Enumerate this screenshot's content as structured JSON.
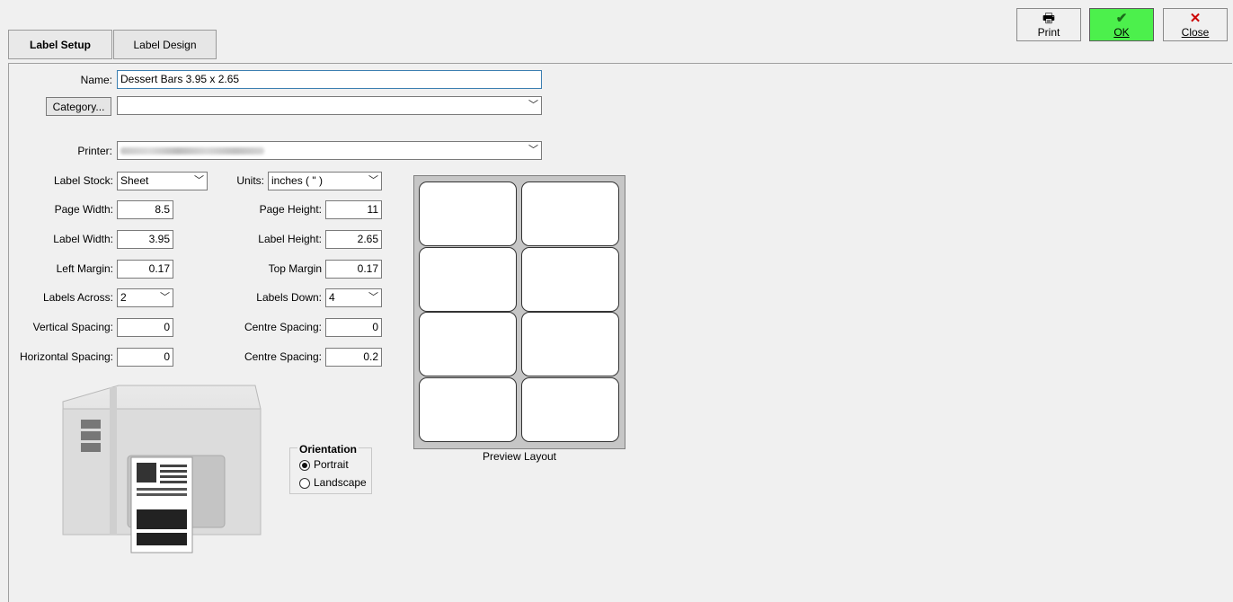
{
  "tabs": {
    "label_setup": "Label Setup",
    "label_design": "Label Design"
  },
  "toolbar": {
    "print": "Print",
    "ok": "OK",
    "close": "Close"
  },
  "form": {
    "name_label": "Name:",
    "name_value": "Dessert Bars 3.95 x 2.65",
    "category_button": "Category...",
    "category_value": "",
    "printer_label": "Printer:",
    "label_stock_label": "Label Stock:",
    "label_stock_value": "Sheet",
    "units_label": "Units:",
    "units_value": "inches ( \" )",
    "page_width_label": "Page Width:",
    "page_width_value": "8.5",
    "page_height_label": "Page Height:",
    "page_height_value": "11",
    "label_width_label": "Label Width:",
    "label_width_value": "3.95",
    "label_height_label": "Label Height:",
    "label_height_value": "2.65",
    "left_margin_label": "Left Margin:",
    "left_margin_value": "0.17",
    "top_margin_label": "Top Margin",
    "top_margin_value": "0.17",
    "labels_across_label": "Labels Across:",
    "labels_across_value": "2",
    "labels_down_label": "Labels Down:",
    "labels_down_value": "4",
    "vertical_spacing_label": "Vertical Spacing:",
    "vertical_spacing_value": "0",
    "centre_spacing_1_label": "Centre Spacing:",
    "centre_spacing_1_value": "0",
    "horizontal_spacing_label": "Horizontal Spacing:",
    "horizontal_spacing_value": "0",
    "centre_spacing_2_label": "Centre Spacing:",
    "centre_spacing_2_value": "0.2"
  },
  "orientation": {
    "title": "Orientation",
    "portrait": "Portrait",
    "landscape": "Landscape",
    "selected": "Portrait"
  },
  "preview": {
    "caption": "Preview Layout"
  },
  "icons": {
    "print": "printer-icon",
    "ok": "checkmark-icon",
    "close": "x-icon"
  },
  "colors": {
    "ok_button": "#4cf04c",
    "close_x": "#cc0000",
    "ok_check": "#1a6b1a"
  }
}
